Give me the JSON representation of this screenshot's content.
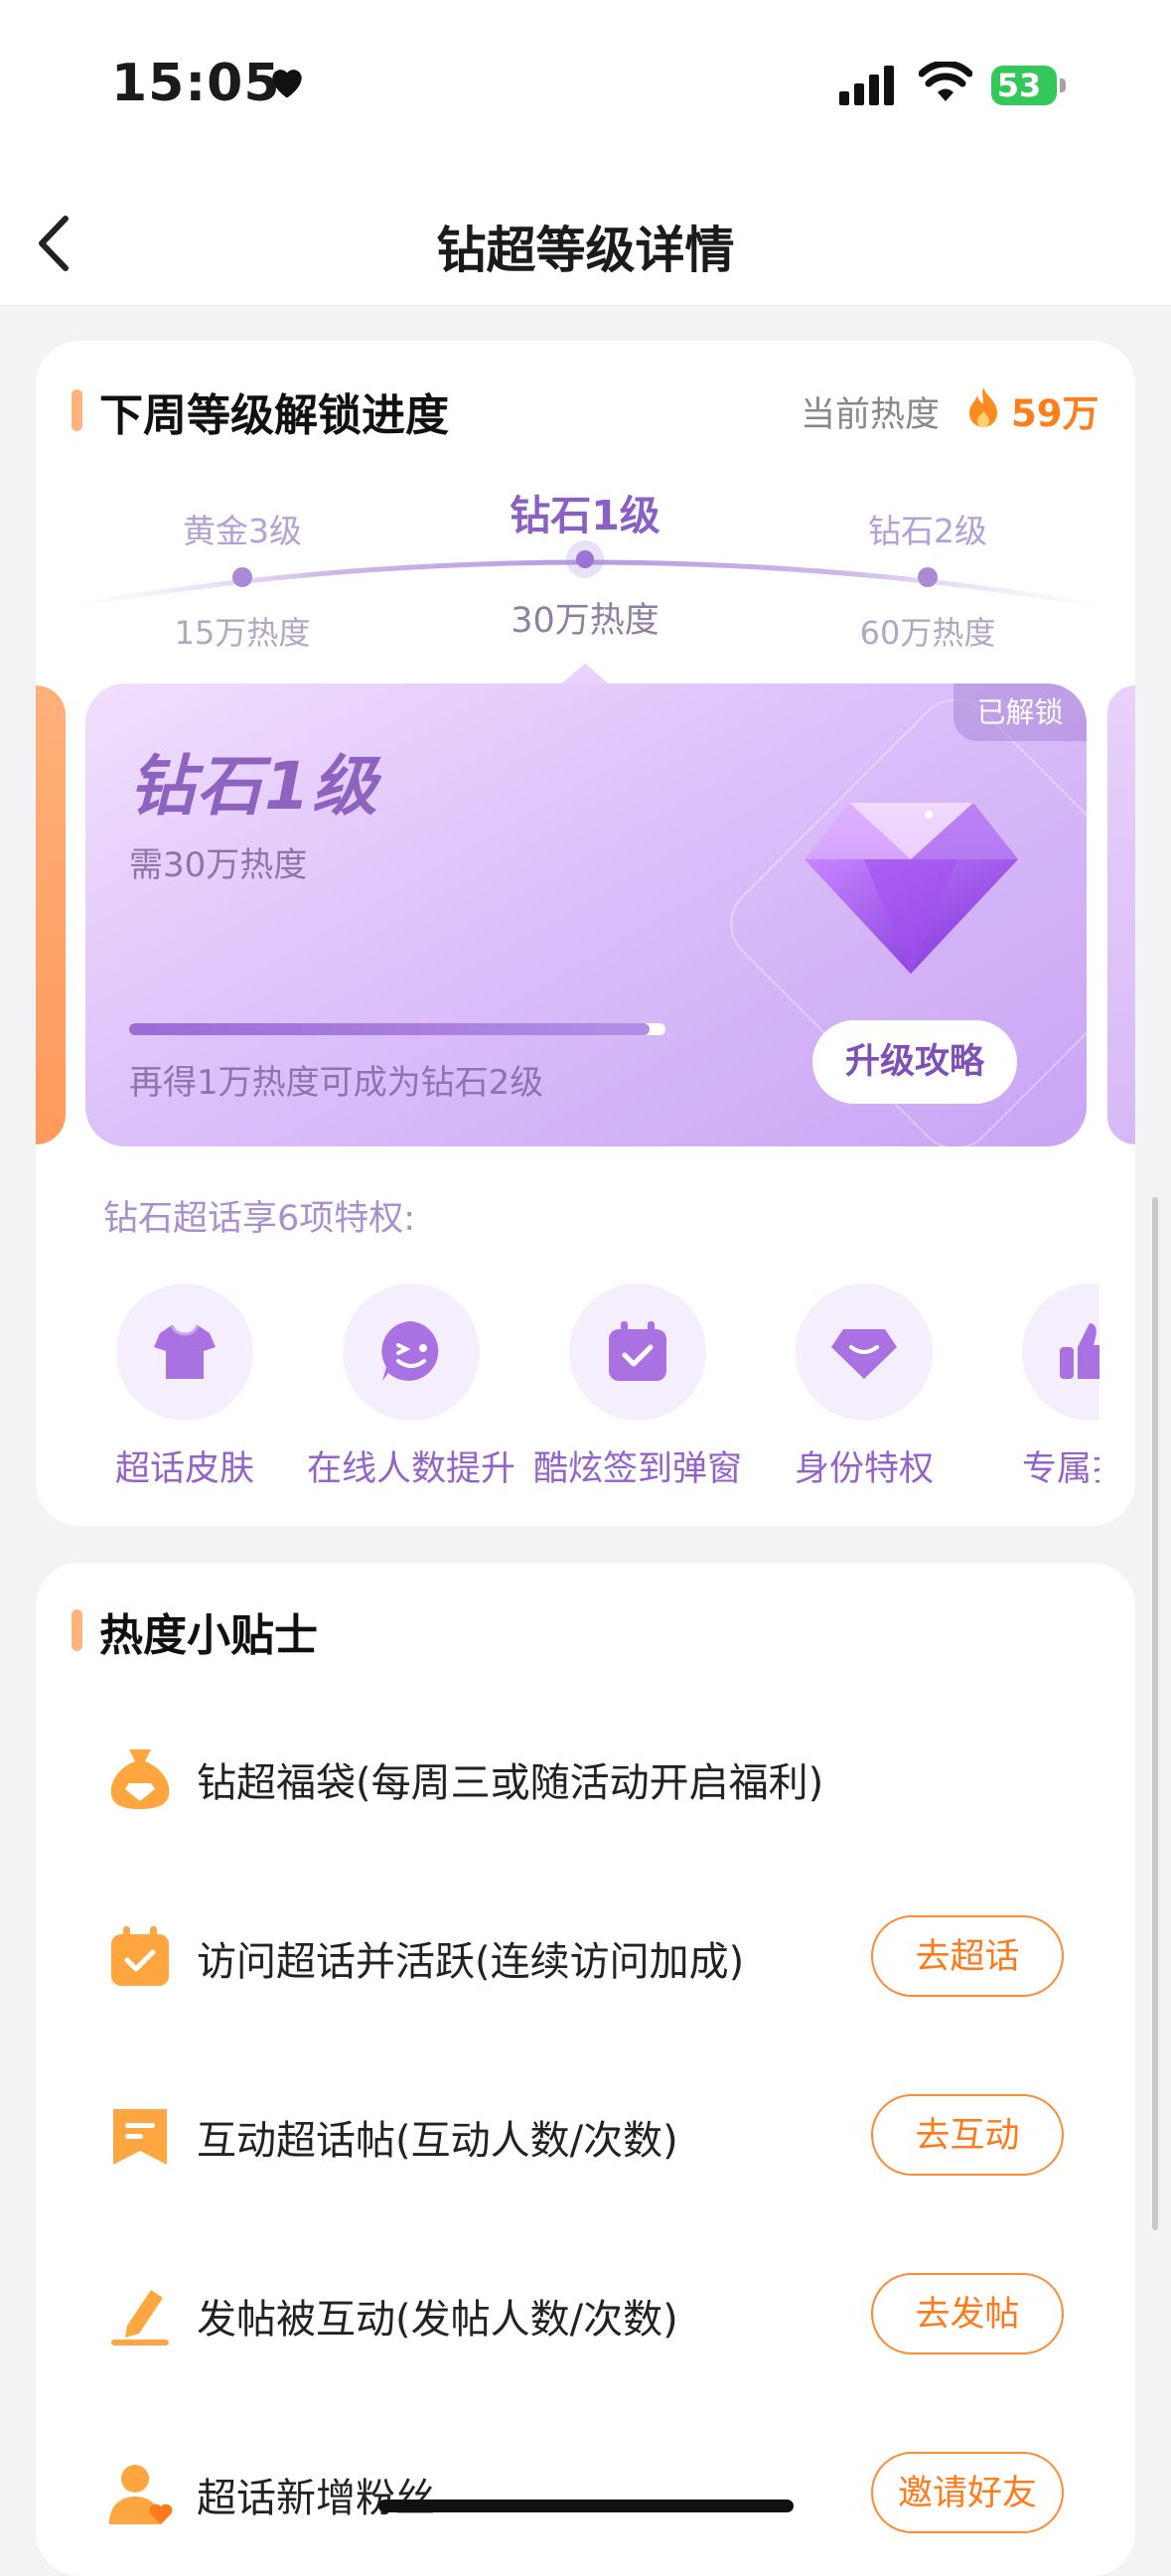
{
  "status": {
    "time": "15:05",
    "battery": "53"
  },
  "nav": {
    "title": "钻超等级详情"
  },
  "progress": {
    "title": "下周等级解锁进度",
    "heat_label": "当前热度",
    "heat_value": "59万",
    "levels": [
      {
        "name": "黄金3级",
        "heat": "15万热度"
      },
      {
        "name": "钻石1级",
        "heat": "30万热度"
      },
      {
        "name": "钻石2级",
        "heat": "60万热度"
      }
    ],
    "card": {
      "badge": "已解锁",
      "title": "钻石1级",
      "subtitle": "需30万热度",
      "progress_fraction": 0.97,
      "hint": "再得1万热度可成为钻石2级",
      "button": "升级攻略"
    },
    "privileges_title": "钻石超话享6项特权:",
    "privileges": [
      {
        "label": "超话皮肤",
        "icon": "shirt-icon"
      },
      {
        "label": "在线人数提升",
        "icon": "wink-face-icon"
      },
      {
        "label": "酷炫签到弹窗",
        "icon": "calendar-check-icon"
      },
      {
        "label": "身份特权",
        "icon": "diamond-badge-icon"
      },
      {
        "label": "专属扌",
        "icon": "thumbs-up-icon"
      }
    ]
  },
  "tips": {
    "title": "热度小贴士",
    "items": [
      {
        "text": "钻超福袋(每周三或随活动开启福利)",
        "icon": "lucky-bag-icon",
        "button": ""
      },
      {
        "text": "访问超话并活跃(连续访问加成)",
        "icon": "calendar-check-icon",
        "button": "去超话"
      },
      {
        "text": "互动超话帖(互动人数/次数)",
        "icon": "bookmark-note-icon",
        "button": "去互动"
      },
      {
        "text": "发帖被互动(发帖人数/次数)",
        "icon": "pencil-icon",
        "button": "去发帖"
      },
      {
        "text": "超话新增粉丝",
        "icon": "user-heart-icon",
        "button": "邀请好友"
      }
    ]
  },
  "colors": {
    "accent": "#ff7e1c",
    "purple": "#8e63c0",
    "background": "#f3f3f5"
  }
}
